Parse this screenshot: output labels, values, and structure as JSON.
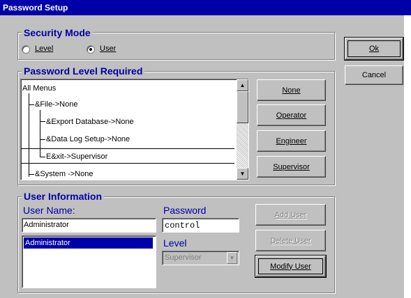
{
  "window": {
    "title": "Password Setup"
  },
  "security_mode": {
    "legend": "Security Mode",
    "options": [
      {
        "label": "Level",
        "selected": false
      },
      {
        "label": "User",
        "selected": true
      }
    ]
  },
  "dialog_buttons": {
    "ok": "Ok",
    "cancel": "Cancel"
  },
  "password_level": {
    "legend": "Password Level Required",
    "tree": [
      {
        "label": "All Menus"
      },
      {
        "label": "&File->None"
      },
      {
        "label": "&Export Database->None"
      },
      {
        "label": "&Data Log Setup->None"
      },
      {
        "label": "E&xit->Supervisor",
        "selected": true
      },
      {
        "label": "&System ->None"
      }
    ],
    "buttons": {
      "none": "None",
      "operator": "Operator",
      "engineer": "Engineer",
      "supervisor": "Supervisor"
    }
  },
  "user_info": {
    "legend": "User Information",
    "username_label": "User Name:",
    "username_value": "Administrator",
    "users": [
      "Administrator"
    ],
    "password_label": "Password",
    "password_value": "control",
    "level_label": "Level",
    "level_value": "Supervisor",
    "buttons": {
      "add": "Add User",
      "delete": "Delete User",
      "modify": "Modify User"
    }
  },
  "colors": {
    "title_bar": "#0000a8",
    "face": "#c0c0c0",
    "label_blue": "#0000a8"
  }
}
